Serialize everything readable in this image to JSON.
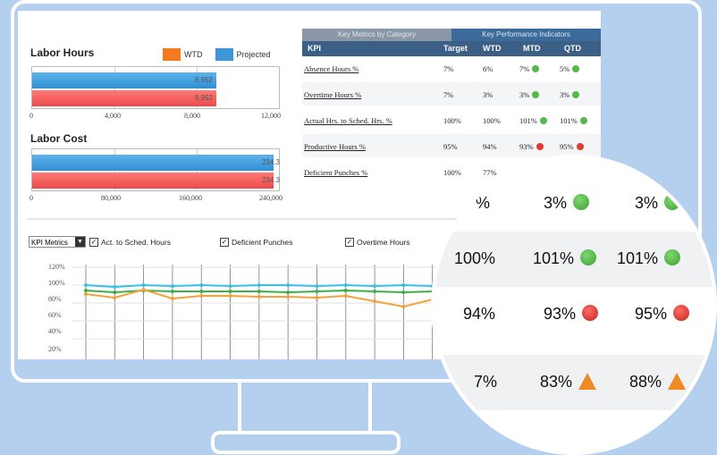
{
  "labor_hours": {
    "title": "Labor Hours",
    "legend": [
      {
        "label": "WTD",
        "color": "#f47a20"
      },
      {
        "label": "Projected",
        "color": "#3d96d8"
      }
    ],
    "bars": [
      {
        "series": "Projected",
        "value": "8,952",
        "fraction": 0.746
      },
      {
        "series": "WTD",
        "value": "8,952",
        "fraction": 0.746
      }
    ],
    "ticks": [
      "0",
      "4,000",
      "8,000",
      "12,000"
    ]
  },
  "labor_cost": {
    "title": "Labor Cost",
    "bars": [
      {
        "series": "Projected",
        "value": "234.3",
        "fraction": 0.98
      },
      {
        "series": "WTD",
        "value": "234.3",
        "fraction": 0.98
      }
    ],
    "ticks": [
      "0",
      "80,000",
      "160,000",
      "240,000"
    ]
  },
  "tabs": [
    "Key Metrics by Category",
    "Key Performance Indicators"
  ],
  "table": {
    "headers": [
      "KPI",
      "Target",
      "WTD",
      "MTD",
      "QTD"
    ],
    "rows": [
      {
        "kpi": "Absence Hours %",
        "target": "7%",
        "wtd": "6%",
        "mtd": "7%",
        "mtd_status": "ok",
        "qtd": "5%",
        "qtd_status": "ok"
      },
      {
        "kpi": "Overtime Hours %",
        "target": "7%",
        "wtd": "3%",
        "mtd": "3%",
        "mtd_status": "ok",
        "qtd": "3%",
        "qtd_status": "ok"
      },
      {
        "kpi": "Actual Hrs. to Sched. Hrs. %",
        "target": "100%",
        "wtd": "100%",
        "mtd": "101%",
        "mtd_status": "ok",
        "qtd": "101%",
        "qtd_status": "ok"
      },
      {
        "kpi": "Productive Hours %",
        "target": "95%",
        "wtd": "94%",
        "mtd": "93%",
        "mtd_status": "bad",
        "qtd": "95%",
        "qtd_status": "bad"
      },
      {
        "kpi": "Deficient Punches %",
        "target": "100%",
        "wtd": "77%",
        "mtd": "",
        "mtd_status": "",
        "qtd": "",
        "qtd_status": ""
      }
    ]
  },
  "controls": {
    "select_value": "KPI Metrics",
    "checkboxes": [
      "Act. to Sched. Hours",
      "Deficient Punches",
      "Overtime Hours"
    ]
  },
  "line_chart": {
    "yticks": [
      "120%",
      "100%",
      "80%",
      "60%",
      "40%",
      "20%"
    ]
  },
  "magnifier": {
    "rows": [
      {
        "wtd": "%",
        "mtd": "3%",
        "mtd_status": "ok",
        "qtd": "3%",
        "qtd_status": "ok"
      },
      {
        "wtd": "100%",
        "mtd": "101%",
        "mtd_status": "ok",
        "qtd": "101%",
        "qtd_status": "ok"
      },
      {
        "wtd": "94%",
        "mtd": "93%",
        "mtd_status": "bad",
        "qtd": "95%",
        "qtd_status": "bad"
      },
      {
        "wtd": "7%",
        "mtd": "83%",
        "mtd_status": "warn",
        "qtd": "88%",
        "qtd_status": "warn"
      }
    ]
  },
  "chart_data": {
    "type": "line",
    "x": [
      1,
      2,
      3,
      4,
      5,
      6,
      7,
      8,
      9,
      10,
      11,
      12,
      13,
      14
    ],
    "yticks": [
      "120%",
      "100%",
      "80%",
      "60%",
      "40%",
      "20%"
    ],
    "ylim": [
      20,
      120
    ],
    "series": [
      {
        "color": "#36c0e8",
        "values": [
          100,
          98,
          100,
          99,
          100,
          99,
          100,
          100,
          99,
          100,
          99,
          100,
          99,
          100
        ]
      },
      {
        "color": "#3fae49",
        "values": [
          94,
          92,
          94,
          93,
          93,
          93,
          93,
          92,
          93,
          94,
          93,
          92,
          93,
          93
        ]
      },
      {
        "color": "#f4a23a",
        "values": [
          90,
          86,
          95,
          85,
          88,
          88,
          87,
          87,
          86,
          88,
          82,
          76,
          84,
          80
        ]
      }
    ]
  }
}
